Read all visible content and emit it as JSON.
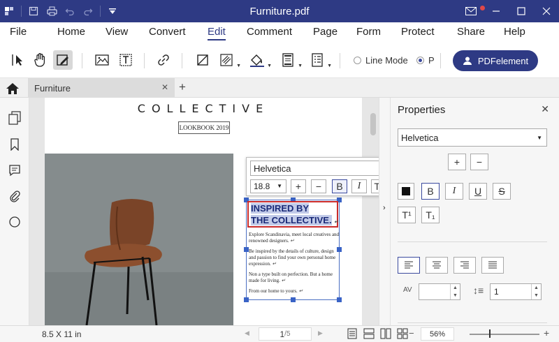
{
  "window": {
    "title": "Furniture.pdf"
  },
  "menu": {
    "items": [
      "File",
      "Home",
      "View",
      "Convert",
      "Edit",
      "Comment",
      "Page",
      "Form",
      "Protect",
      "Share",
      "Help"
    ],
    "active": "Edit"
  },
  "toolbar": {
    "mode_line": "Line Mode",
    "mode_paragraph": "P",
    "pdfelement_button": "PDFelement"
  },
  "tabs": {
    "document_tab": "Furniture"
  },
  "document": {
    "brand": "COLLECTIVE",
    "lookbook": "LOOKBOOK 2019",
    "heading_line1": "INSPIRED BY",
    "heading_line2": "THE COLLECTIVE.",
    "paragraphs": [
      "Explore Scandinavia, meet local creatives and renowned designers.",
      "Be inspired by the details of culture, design and passion to find your own personal home expression.",
      "Non a type built on perfection. But a home made for living.",
      "From our home to yours."
    ]
  },
  "format_bar": {
    "font": "Helvetica",
    "size": "18.8",
    "buttons": [
      "+",
      "−",
      "B",
      "I",
      "T¹",
      "T₁",
      "■"
    ]
  },
  "properties": {
    "title": "Properties",
    "font": "Helvetica",
    "line_spacing": "1"
  },
  "status": {
    "page_size": "8.5 X 11 in",
    "current_page": "1",
    "total_pages": "/5",
    "zoom": "56%"
  },
  "colors": {
    "brand": "#2e3a84",
    "selection": "#3a63c6",
    "highlight_border": "#c92a2a"
  }
}
